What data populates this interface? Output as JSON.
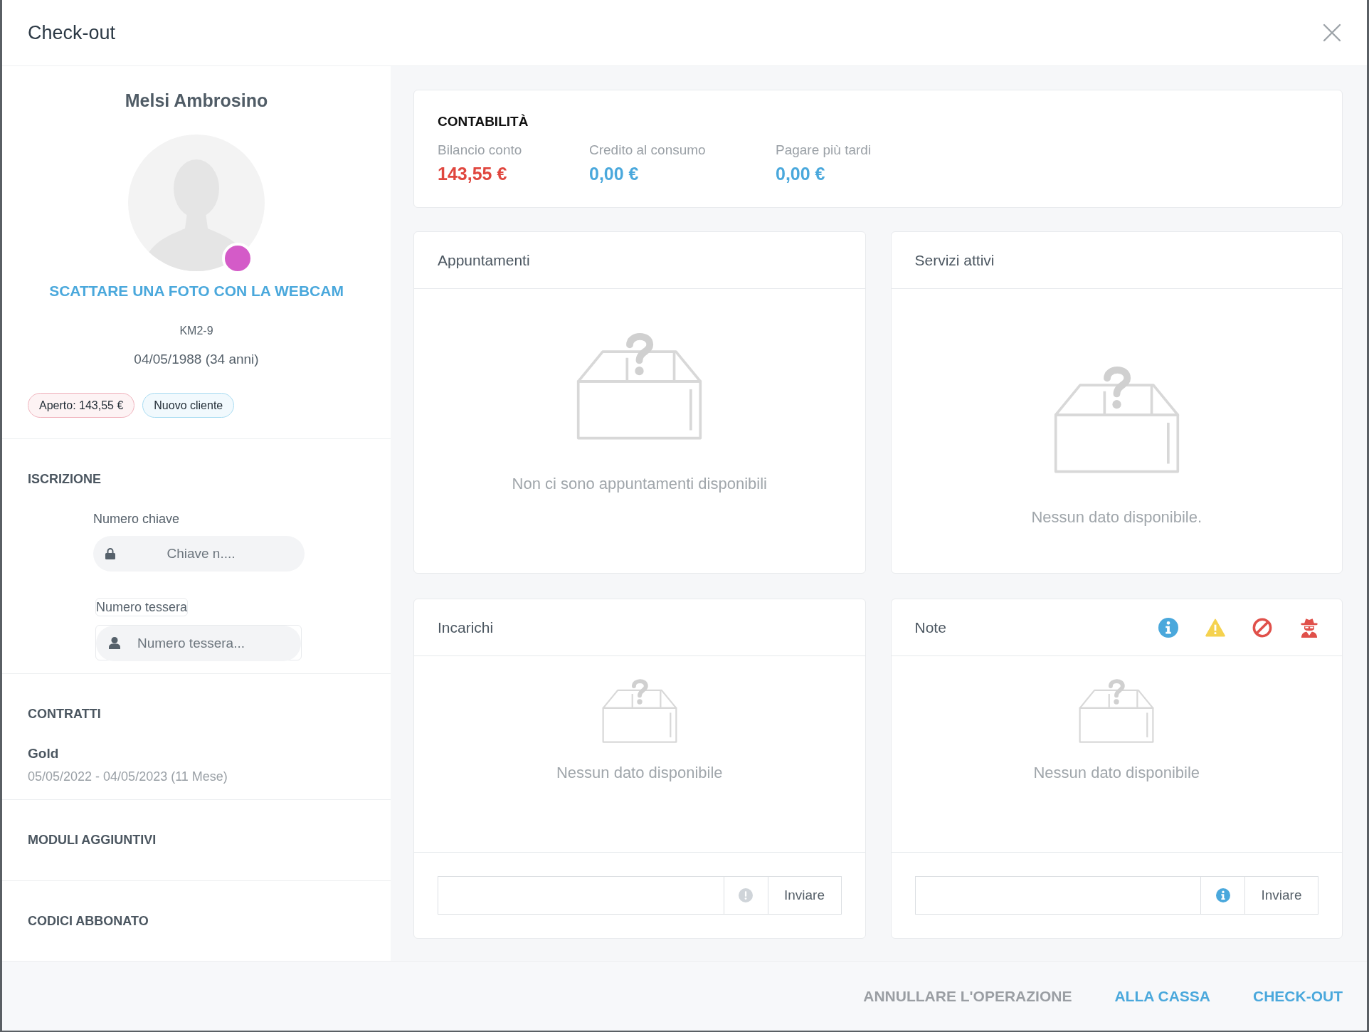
{
  "window": {
    "title": "Check-out"
  },
  "profile": {
    "name": "Melsi Ambrosino",
    "status_dot": {
      "color": "#d45bc8"
    },
    "webcam_link": "SCATTARE UNA FOTO CON LA WEBCAM",
    "code": "KM2-9",
    "birth_date": "04/05/1988 (34 anni)",
    "badges": [
      {
        "label": "Aperto: 143,55 €",
        "color": "#f0b3bd"
      },
      {
        "label": "Nuovo cliente",
        "color": "#a9dcf2"
      }
    ]
  },
  "iscrizione": {
    "title": "ISCRIZIONE",
    "key_field": {
      "label": "Numero chiave",
      "placeholder": "Chiave n...."
    },
    "card_field": {
      "label": "Numero tessera",
      "placeholder": "Numero tessera..."
    }
  },
  "contratti": {
    "title": "CONTRATTI",
    "items": [
      {
        "name": "Gold",
        "period": "05/05/2022 - 04/05/2023 (11 Mese)"
      }
    ]
  },
  "moduli_aggiuntivi": {
    "title": "MODULI AGGIUNTIVI"
  },
  "codici_abbonato": {
    "title": "CODICI ABBONATO"
  },
  "contabilita": {
    "title": "CONTABILITÀ",
    "items": [
      {
        "label": "Bilancio conto",
        "value": "143,55 €",
        "color": "#e0473f"
      },
      {
        "label": "Credito al consumo",
        "value": "0,00 €",
        "color": "#4aa8dc"
      },
      {
        "label": "Pagare più tardi",
        "value": "0,00 €",
        "color": "#4aa8dc"
      }
    ]
  },
  "appuntamenti": {
    "title": "Appuntamenti",
    "empty_message": "Non ci sono appuntamenti disponibili"
  },
  "servizi_attivi": {
    "title": "Servizi attivi",
    "empty_message": "Nessun dato disponibile."
  },
  "incarichi": {
    "title": "Incarichi",
    "empty_message": "Nessun dato disponibile",
    "send_button": "Inviare"
  },
  "note": {
    "title": "Note",
    "empty_message": "Nessun dato disponibile",
    "send_button": "Inviare"
  },
  "footer": {
    "buttons": [
      {
        "label": "ANNULLARE L'OPERAZIONE",
        "kind": "cancel"
      },
      {
        "label": "ALLA CASSA",
        "kind": "primary"
      },
      {
        "label": "CHECK-OUT",
        "kind": "primary"
      }
    ]
  }
}
